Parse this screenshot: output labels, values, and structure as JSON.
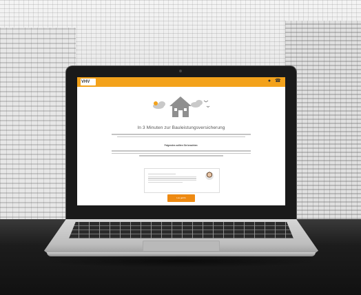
{
  "brand": {
    "logo_text": "VHV",
    "accent_color": "#f3a21b",
    "cta_color": "#ee8a12"
  },
  "nav": {
    "icons": [
      "profile-icon",
      "phone-icon"
    ]
  },
  "content": {
    "headline": "In 3 Minuten zur Bauleistungsversicherung",
    "subhead": "Folgendes sollten Sie beachten:",
    "cta_label": "Los geht's"
  }
}
